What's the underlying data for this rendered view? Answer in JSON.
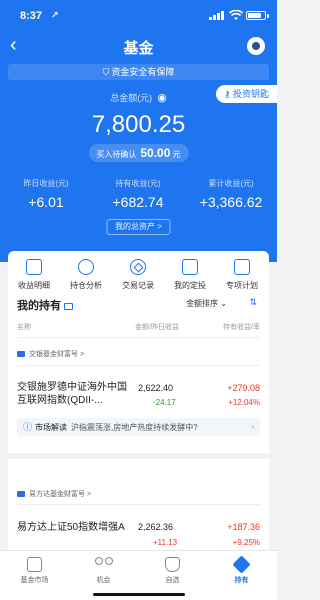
{
  "status_bar": {
    "time": "8:37",
    "location_glyph": "↗"
  },
  "nav": {
    "back": "‹",
    "title": "基金"
  },
  "safety_banner": "资金安全有保障",
  "invest_key": "投资钥匙",
  "summary": {
    "total_label": "总金额(元)",
    "total_value": "7,800.25",
    "pending_label": "买入待确认",
    "pending_value": "50.00",
    "pending_unit": "元",
    "yesterday_label": "昨日收益(元)",
    "yesterday_value": "+6.01",
    "holding_label": "持有收益(元)",
    "holding_value": "+682.74",
    "cumulative_label": "累计收益(元)",
    "cumulative_value": "+3,366.62",
    "assets_button": "我的总资产 >"
  },
  "quick_actions": [
    "收益明细",
    "持仓分析",
    "交易记录",
    "我的定投",
    "专项计划"
  ],
  "holdings": {
    "title": "我的持有",
    "sort_label": "金额排序 ⌄",
    "columns": {
      "name": "名称",
      "amount": "金额/昨日收益",
      "profit": "持有收益/率"
    },
    "groups": [
      {
        "company": "交银基金财富号 >",
        "fund_name": "交银施罗德中证海外中国互联网指数(QDII-...",
        "amount": "2,622.40",
        "yesterday": "-24.17",
        "hold_profit": "+279.08",
        "hold_rate": "+12.04%",
        "insight_badge": "市场解读",
        "insight_text": "沪指震荡涨,房地产热度持续发酵中?"
      },
      {
        "company": "易方达基金财富号 >",
        "fund_name": "易方达上证50指数增强A",
        "amount": "2,262.36",
        "yesterday": "+11.13",
        "hold_profit": "+187.36",
        "hold_rate": "+9.25%"
      }
    ]
  },
  "tabs": [
    "基金市场",
    "机会",
    "自选",
    "持有"
  ],
  "colors": {
    "primary": "#1f74f0",
    "up": "#e8382a",
    "down": "#2b9b3f"
  }
}
